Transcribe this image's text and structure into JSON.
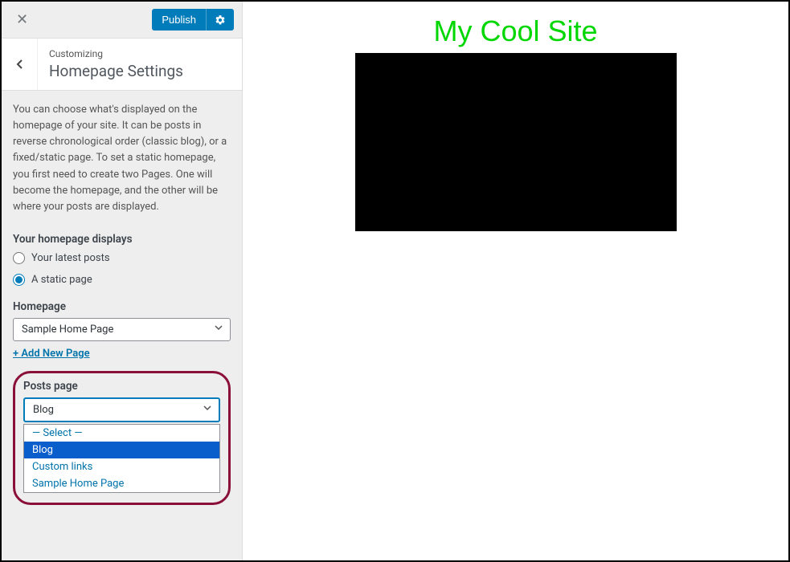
{
  "topbar": {
    "publish_label": "Publish"
  },
  "header": {
    "breadcrumb": "Customizing",
    "title": "Homepage Settings"
  },
  "intro": "You can choose what's displayed on the homepage of your site. It can be posts in reverse chronological order (classic blog), or a fixed/static page. To set a static homepage, you first need to create two Pages. One will become the homepage, and the other will be where your posts are displayed.",
  "display_group": {
    "heading": "Your homepage displays",
    "option_latest": "Your latest posts",
    "option_static": "A static page"
  },
  "homepage_field": {
    "label": "Homepage",
    "value": "Sample Home Page",
    "add_link": "+ Add New Page"
  },
  "posts_field": {
    "label": "Posts page",
    "value": "Blog",
    "options": {
      "placeholder": "— Select —",
      "o1": "Blog",
      "o2": "Custom links",
      "o3": "Sample Home Page"
    }
  },
  "preview": {
    "site_title": "My Cool Site"
  }
}
